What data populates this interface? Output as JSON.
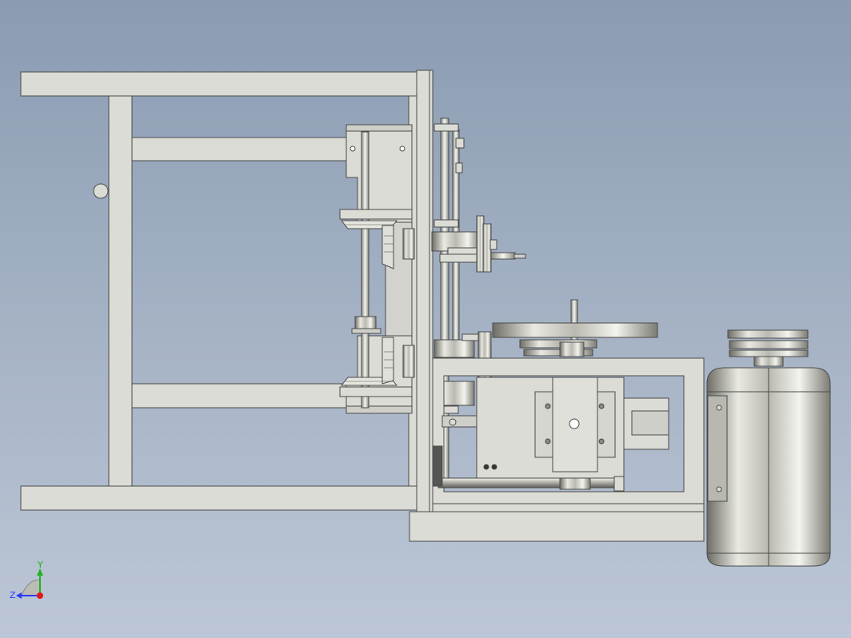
{
  "viewport": {
    "background_top": "#8a9bb2",
    "background_bottom": "#bcc6d6"
  },
  "model": {
    "part_color": "#dcdcd6",
    "edge_color": "#4a4a4a",
    "motor_color": "#c8c8c0"
  },
  "triad": {
    "y_label": "Y",
    "z_label": "Z",
    "y_color": "#1fb31f",
    "z_color": "#2b3cff",
    "origin_color": "#e01818"
  }
}
